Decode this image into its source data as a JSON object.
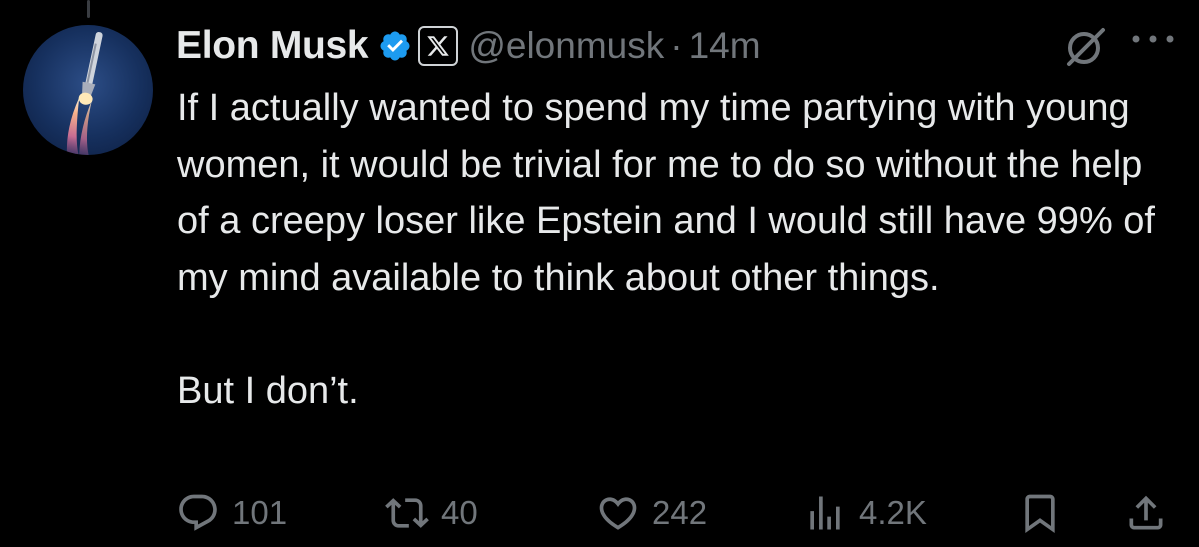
{
  "author": {
    "name": "Elon Musk",
    "handle": "@elonmusk",
    "separator": "·",
    "time": "14m",
    "verified": true,
    "affiliate_badge": "X"
  },
  "tweet": {
    "text": "If I actually wanted to spend my time partying with young women, it would be trivial for me to do so without the help of a creepy loser like Epstein and I would still have 99% of my mind available to think about other things.\n\nBut I don’t."
  },
  "actions": {
    "replies": "101",
    "reposts": "40",
    "likes": "242",
    "views": "4.2K"
  },
  "icons": {
    "avatar": "rocket-avatar",
    "verified": "verified-badge-icon",
    "affiliate": "x-logo-icon",
    "grok": "grok-icon",
    "more": "more-icon",
    "reply": "reply-icon",
    "repost": "repost-icon",
    "like": "heart-icon",
    "views": "views-icon",
    "bookmark": "bookmark-icon",
    "share": "share-icon"
  },
  "colors": {
    "background": "#000000",
    "text": "#e7e9ea",
    "secondary": "#71767b",
    "verified": "#1d9bf0"
  }
}
